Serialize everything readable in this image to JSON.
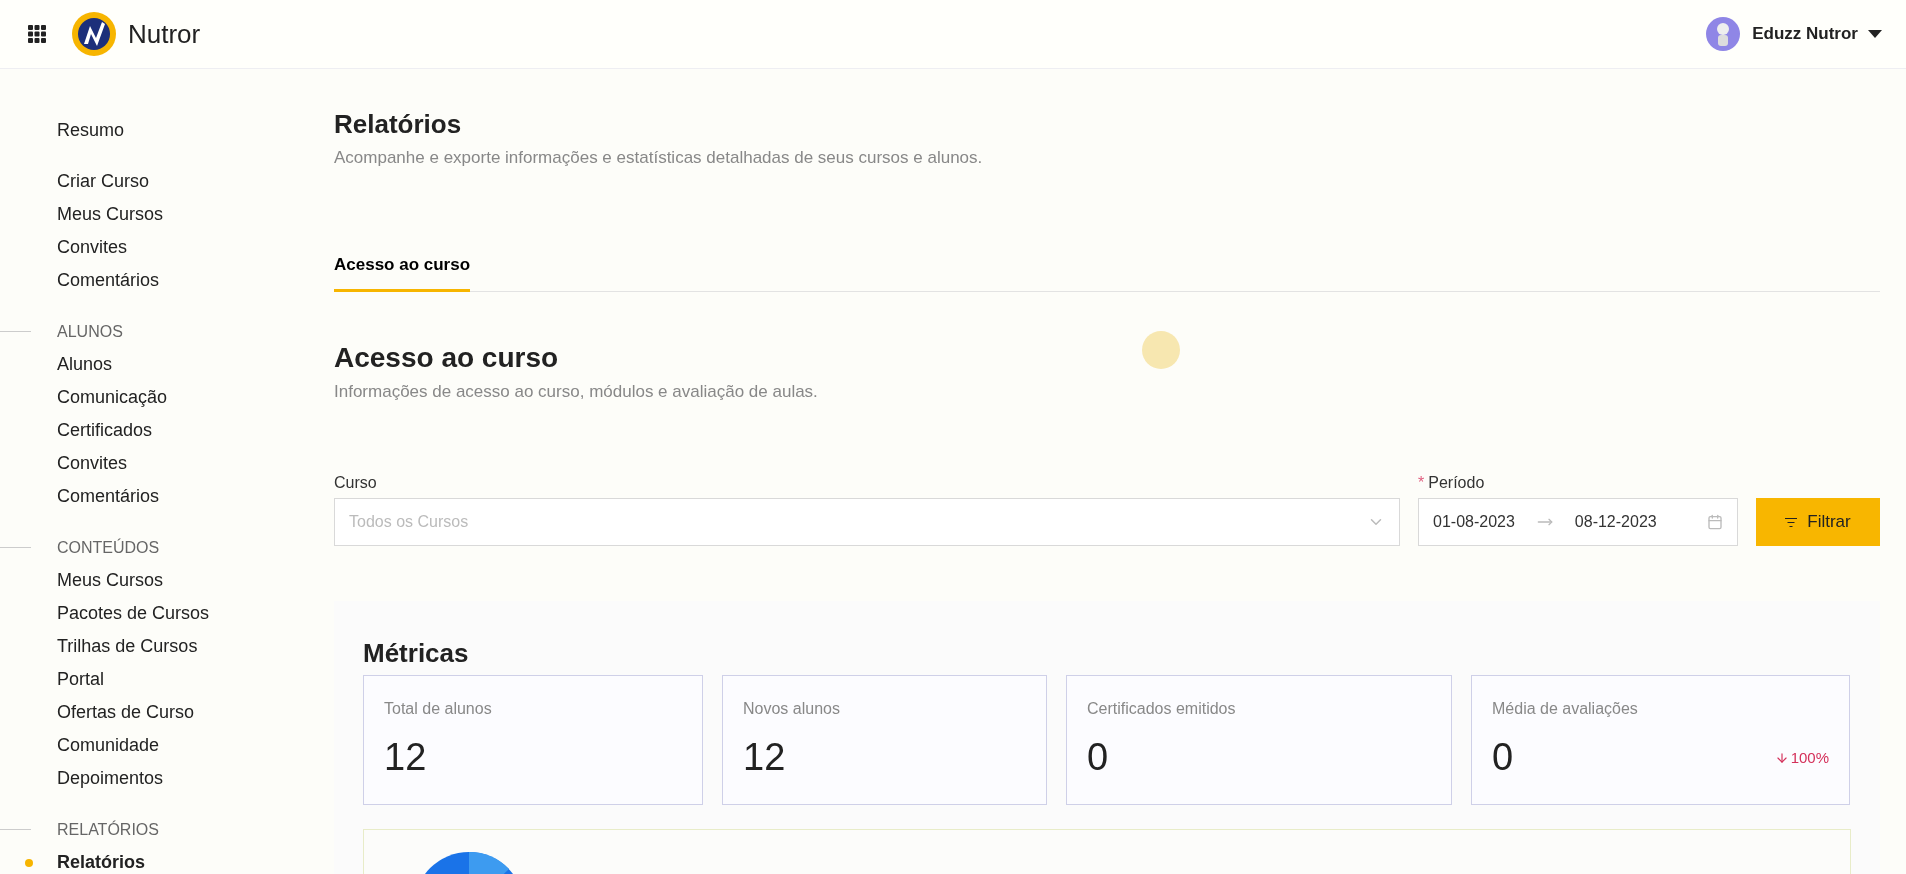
{
  "header": {
    "brand": "Nutror",
    "user": "Eduzz Nutror"
  },
  "sidebar": {
    "groups": [
      {
        "items": [
          {
            "label": "Resumo",
            "selected": false
          }
        ]
      },
      {
        "items": [
          {
            "label": "Criar Curso",
            "selected": false
          },
          {
            "label": "Meus Cursos",
            "selected": false
          },
          {
            "label": "Convites",
            "selected": false
          },
          {
            "label": "Comentários",
            "selected": false
          }
        ]
      },
      {
        "heading": "ALUNOS",
        "items": [
          {
            "label": "Alunos",
            "selected": false
          },
          {
            "label": "Comunicação",
            "selected": false
          },
          {
            "label": "Certificados",
            "selected": false
          },
          {
            "label": "Convites",
            "selected": false
          },
          {
            "label": "Comentários",
            "selected": false
          }
        ]
      },
      {
        "heading": "CONTEÚDOS",
        "items": [
          {
            "label": "Meus Cursos",
            "selected": false
          },
          {
            "label": "Pacotes de Cursos",
            "selected": false
          },
          {
            "label": "Trilhas de Cursos",
            "selected": false
          },
          {
            "label": "Portal",
            "selected": false
          },
          {
            "label": "Ofertas de Curso",
            "selected": false
          },
          {
            "label": "Comunidade",
            "selected": false
          },
          {
            "label": "Depoimentos",
            "selected": false
          }
        ]
      },
      {
        "heading": "RELATÓRIOS",
        "items": [
          {
            "label": "Relatórios",
            "selected": true
          }
        ]
      }
    ]
  },
  "page": {
    "title": "Relatórios",
    "subtitle": "Acompanhe e exporte informações e estatísticas detalhadas de seus cursos e alunos."
  },
  "tabs": [
    {
      "label": "Acesso ao curso",
      "selected": true
    }
  ],
  "section": {
    "title": "Acesso ao curso",
    "subtitle": "Informações de acesso ao curso, módulos e avaliação de aulas."
  },
  "filters": {
    "course": {
      "label": "Curso",
      "placeholder": "Todos os Cursos"
    },
    "period": {
      "label": "Período",
      "required_mark": "*",
      "start": "01-08-2023",
      "end": "08-12-2023"
    },
    "button": "Filtrar"
  },
  "metrics": {
    "title": "Métricas",
    "cards": [
      {
        "label": "Total de alunos",
        "value": "12"
      },
      {
        "label": "Novos alunos",
        "value": "12"
      },
      {
        "label": "Certificados emitidos",
        "value": "0"
      },
      {
        "label": "Média de avaliações",
        "value": "0",
        "change": {
          "negative": true,
          "text": "100%"
        }
      }
    ]
  }
}
